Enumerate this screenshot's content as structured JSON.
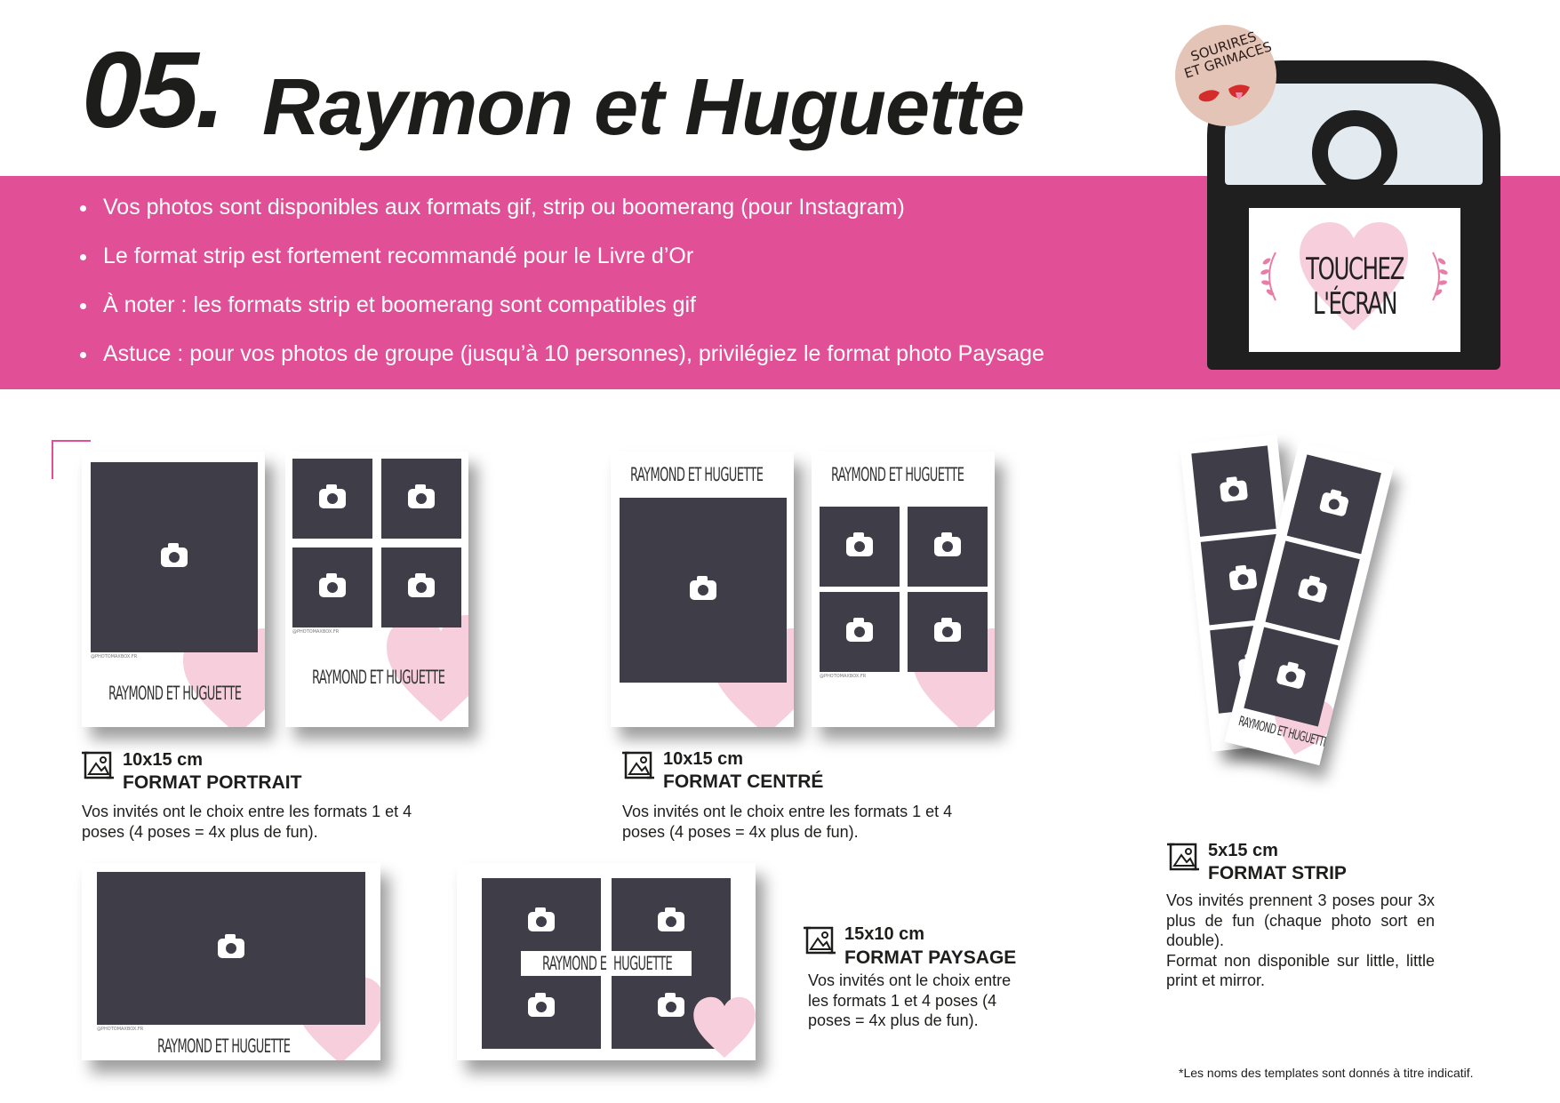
{
  "header": {
    "number": "05.",
    "title": "Raymon et Huguette"
  },
  "bullets": [
    "Vos photos sont disponibles aux formats gif, strip ou boomerang (pour Instagram)",
    "Le format strip est fortement recommandé pour le Livre d’Or",
    "À noter : les formats strip et boomerang sont compatibles gif",
    "Astuce : pour vos photos de groupe (jusqu’à 10 personnes), privilégiez le format photo Paysage"
  ],
  "booth": {
    "badge_line1": "SOURIRES",
    "badge_line2": "ET GRIMACES",
    "screen_line1": "TOUCHEZ",
    "screen_line2": "L'ÉCRAN"
  },
  "template_brand": "RAYMOND ET HUGUETTE",
  "template_brand_split_left": "RAYMOND E",
  "template_brand_split_right": "HUGUETTE",
  "template_credit": "@PHOTOMAXBOX.FR",
  "formats": {
    "portrait": {
      "size": "10x15 cm",
      "name": "FORMAT PORTRAIT",
      "desc": "Vos invités ont le choix entre les formats 1 et 4 poses (4 poses = 4x plus de fun)."
    },
    "centre": {
      "size": "10x15 cm",
      "name": "FORMAT CENTRÉ",
      "desc": "Vos invités ont le choix entre les formats 1 et 4 poses (4 poses = 4x plus de fun)."
    },
    "strip": {
      "size": "5x15 cm",
      "name": "FORMAT STRIP",
      "desc1": "Vos invités prennent 3 poses pour 3x plus de fun (chaque photo sort en double).",
      "desc2": "Format non disponible sur little, little print et mirror."
    },
    "paysage": {
      "size": "15x10 cm",
      "name": "FORMAT PAYSAGE",
      "desc": "Vos invités ont le choix entre les formats 1 et 4 poses (4 poses = 4x plus de fun)."
    }
  },
  "footnote": "*Les noms des templates sont donnés à titre indicatif.",
  "colors": {
    "accent": "#e14f96",
    "photo": "#3e3d48",
    "heart": "#f7cfdc"
  },
  "icons": [
    "camera-icon",
    "heart-decoration",
    "laurel-icon",
    "photo-format-icon"
  ]
}
